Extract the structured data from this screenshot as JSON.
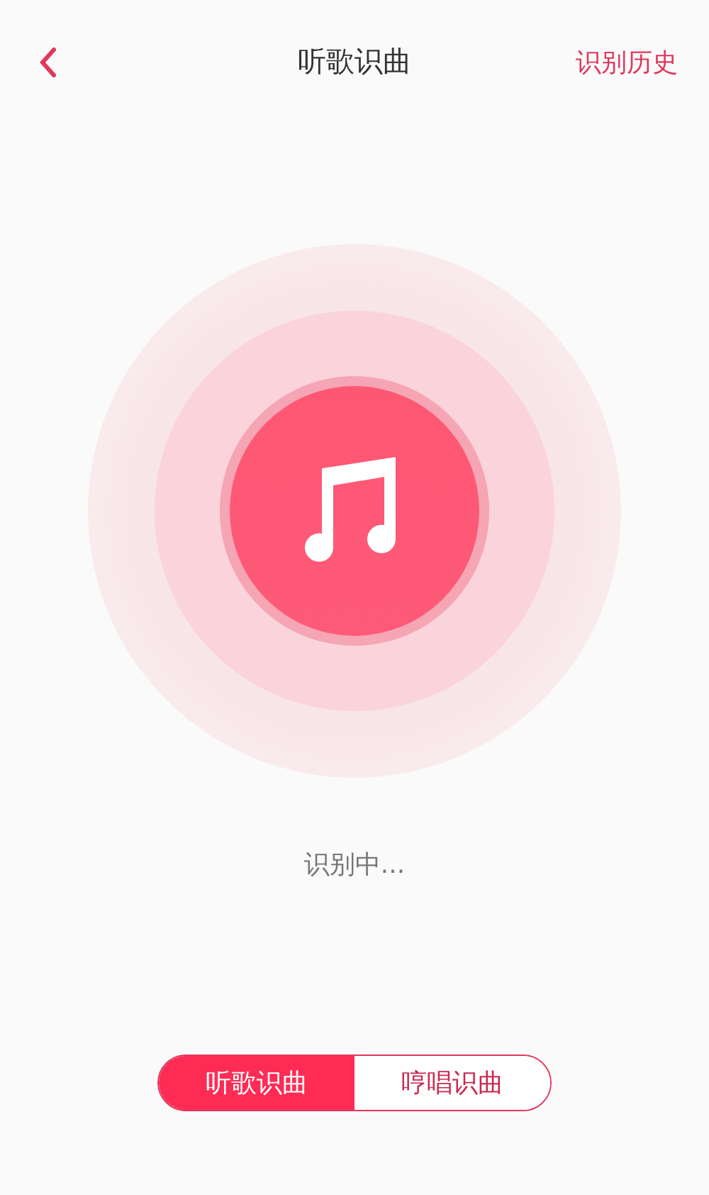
{
  "header": {
    "title": "听歌识曲",
    "action": "识别历史"
  },
  "status": "识别中...",
  "tabs": [
    {
      "label": "听歌识曲",
      "selected": true
    },
    {
      "label": "哼唱识曲",
      "selected": false
    }
  ]
}
